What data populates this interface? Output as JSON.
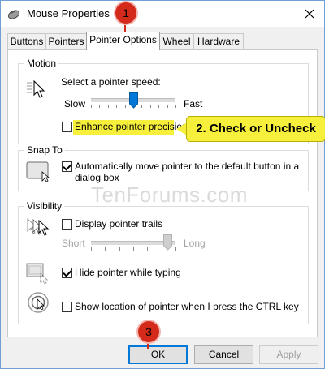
{
  "window": {
    "title": "Mouse Properties"
  },
  "tabs": [
    {
      "label": "Buttons"
    },
    {
      "label": "Pointers"
    },
    {
      "label": "Pointer Options"
    },
    {
      "label": "Wheel"
    },
    {
      "label": "Hardware"
    }
  ],
  "motion": {
    "label": "Motion",
    "speed_label": "Select a pointer speed:",
    "slow": "Slow",
    "fast": "Fast",
    "speed_value": 0.5,
    "precision_label": "Enhance pointer precision",
    "precision_checked": false
  },
  "snap": {
    "label": "Snap To",
    "option_line1": "Automatically move pointer to the default button in a",
    "option_line2": "dialog box",
    "checked": true
  },
  "visibility": {
    "label": "Visibility",
    "trails_label": "Display pointer trails",
    "trails_checked": false,
    "short": "Short",
    "long": "Long",
    "trails_value": 0.9,
    "hide_label": "Hide pointer while typing",
    "hide_checked": true,
    "ctrl_label": "Show location of pointer when I press the CTRL key",
    "ctrl_checked": false
  },
  "buttons": {
    "ok": "OK",
    "cancel": "Cancel",
    "apply": "Apply"
  },
  "annotations": {
    "badge1": "1",
    "badge3": "3",
    "callout": "2. Check or Uncheck",
    "highlight_color": "#f6ef3b",
    "marker_color": "#d42a1b"
  },
  "watermark": "TenForums.com"
}
